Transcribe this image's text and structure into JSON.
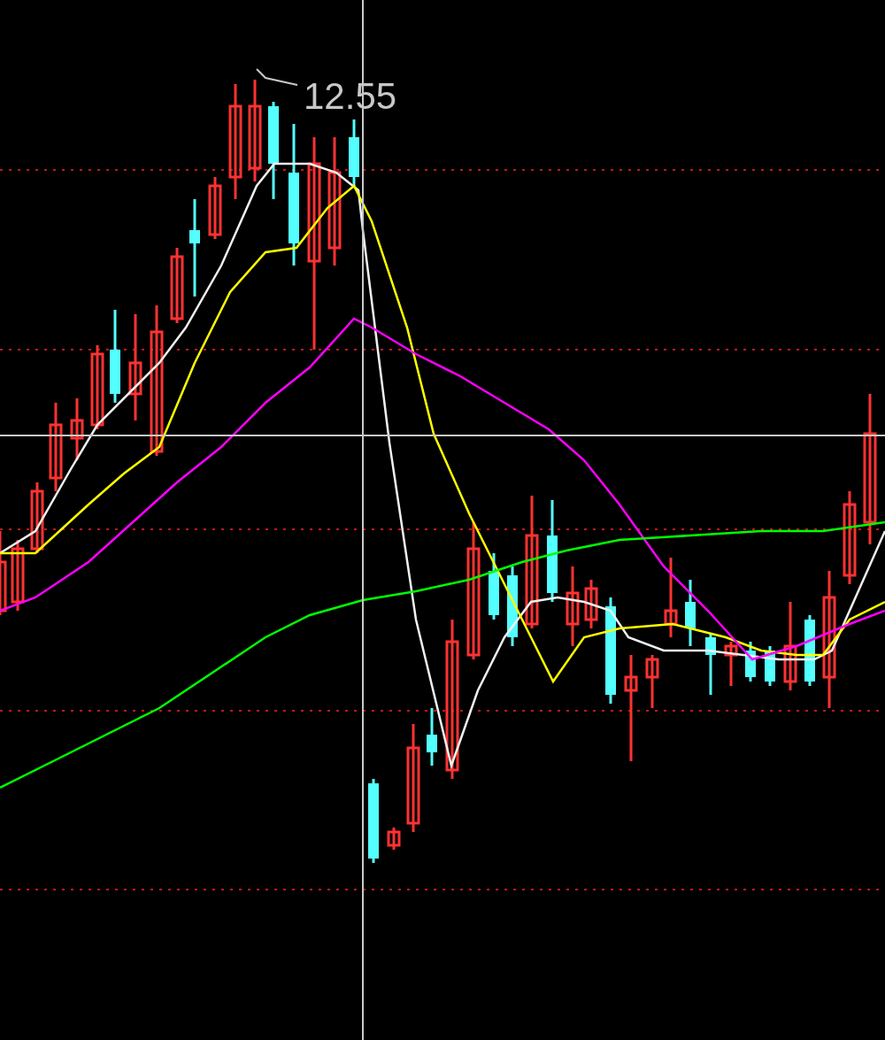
{
  "chart": {
    "price_label": "12.55"
  }
}
